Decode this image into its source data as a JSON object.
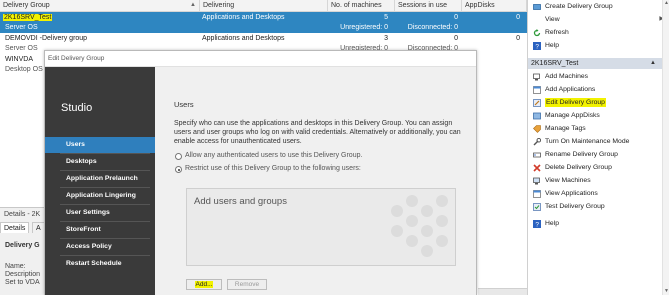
{
  "grid": {
    "columns": [
      "Delivery Group",
      "Delivering",
      "No. of machines",
      "Sessions in use",
      "AppDisks"
    ],
    "rows": [
      {
        "name": "2K16SRV_Test",
        "sub": "Server OS",
        "delivering": "Applications and Desktops",
        "machines": "5",
        "unregistered": "Unregistered: 0",
        "sessions": "0",
        "disconnected": "Disconnected: 0",
        "appdisks": "0",
        "selected": true
      },
      {
        "name": "DEMOVDI -Delivery group",
        "sub": "Server OS",
        "delivering": "Applications and Desktops",
        "machines": "3",
        "unregistered": "Unregistered: 0",
        "sessions": "0",
        "disconnected": "Disconnected: 0",
        "appdisks": "0",
        "selected": false
      },
      {
        "name": "WINVDA",
        "sub": "Desktop OS",
        "delivering": "",
        "machines": "",
        "unregistered": "",
        "sessions": "",
        "disconnected": "",
        "appdisks": "",
        "selected": false
      }
    ]
  },
  "details": {
    "title": "Details - 2K",
    "tabs": [
      "Details",
      "A"
    ],
    "heading": "Delivery G",
    "lines": [
      "Name:",
      "Description",
      "Set to VDA"
    ]
  },
  "dialog": {
    "title": "Edit Delivery Group",
    "brand": "Studio",
    "nav": [
      "Users",
      "Desktops",
      "Application Prelaunch",
      "Application Lingering",
      "User Settings",
      "StoreFront",
      "Access Policy",
      "Restart Schedule"
    ],
    "current_nav": "Users",
    "pane_title": "Users",
    "description": "Specify who can use the applications and desktops in this Delivery Group. You can assign users and user groups who log on with valid credentials. Alternatively or additionally, you can enable access for unauthenticated users.",
    "radio_allow": "Allow any authenticated users to use this Delivery Group.",
    "radio_restrict": "Restrict use of this Delivery Group to the following users:",
    "restrict_selected": true,
    "users_box_placeholder": "Add users and groups",
    "add_button": "Add...",
    "remove_button": "Remove"
  },
  "actions": {
    "top_items": [
      {
        "label": "Create Delivery Group",
        "icon": "create-group-icon"
      },
      {
        "label": "View",
        "icon": "",
        "submenu": true
      },
      {
        "label": "Refresh",
        "icon": "refresh-icon"
      },
      {
        "label": "Help",
        "icon": "help-icon"
      }
    ],
    "section_title": "2K16SRV_Test",
    "section_items": [
      {
        "label": "Add Machines",
        "icon": "add-machines-icon"
      },
      {
        "label": "Add Applications",
        "icon": "add-applications-icon"
      },
      {
        "label": "Edit Delivery Group",
        "icon": "edit-group-icon",
        "highlight": true
      },
      {
        "label": "Manage AppDisks",
        "icon": "appdisks-icon"
      },
      {
        "label": "Manage Tags",
        "icon": "tag-icon"
      },
      {
        "label": "Turn On Maintenance Mode",
        "icon": "maintenance-icon"
      },
      {
        "label": "Rename Delivery Group",
        "icon": "rename-icon"
      },
      {
        "label": "Delete Delivery Group",
        "icon": "delete-icon"
      },
      {
        "label": "View Machines",
        "icon": "view-machines-icon"
      },
      {
        "label": "View Applications",
        "icon": "view-applications-icon"
      },
      {
        "label": "Test Delivery Group",
        "icon": "test-icon"
      },
      {
        "label": "Help",
        "icon": "help-icon"
      }
    ]
  },
  "colors": {
    "selection": "#2e86c1",
    "nav_bg": "#3a3a3a",
    "nav_current": "#2f7fbd",
    "highlight": "#f2f200"
  }
}
